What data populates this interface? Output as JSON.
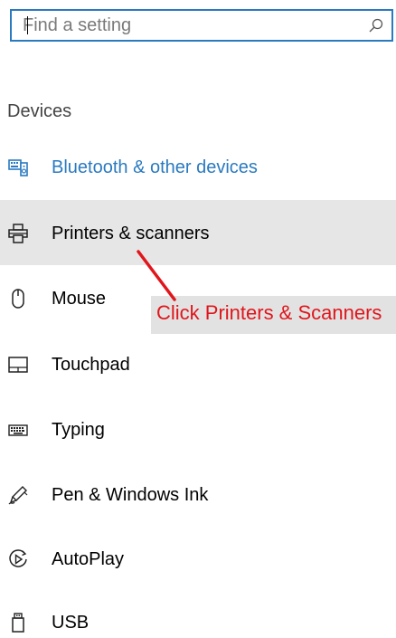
{
  "search": {
    "placeholder": "Find a setting",
    "icon": "search-icon"
  },
  "section": {
    "header": "Devices"
  },
  "nav": {
    "items": [
      {
        "label": "Bluetooth & other devices",
        "icon": "bluetooth-devices-icon",
        "active": true
      },
      {
        "label": "Printers & scanners",
        "icon": "printer-icon",
        "selected": true
      },
      {
        "label": "Mouse",
        "icon": "mouse-icon"
      },
      {
        "label": "Touchpad",
        "icon": "touchpad-icon"
      },
      {
        "label": "Typing",
        "icon": "keyboard-icon"
      },
      {
        "label": "Pen & Windows Ink",
        "icon": "pen-icon"
      },
      {
        "label": "AutoPlay",
        "icon": "autoplay-icon"
      },
      {
        "label": "USB",
        "icon": "usb-icon"
      }
    ]
  },
  "annotation": {
    "text": "Click Printers & Scanners"
  },
  "colors": {
    "accent": "#2a7ac0",
    "selected_bg": "#e6e6e6",
    "annotation_red": "#e0161c"
  }
}
